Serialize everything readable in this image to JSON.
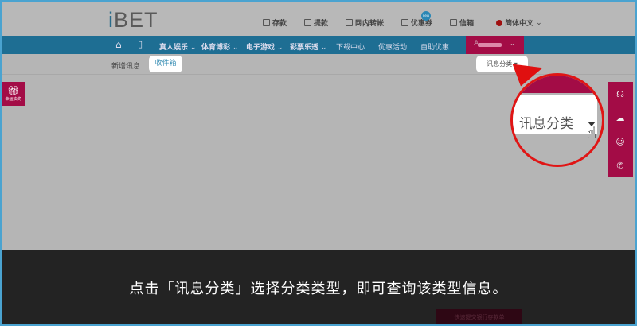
{
  "header": {
    "logo": "BET",
    "logo_i": "i",
    "links": [
      "存款",
      "提款",
      "网内转帐",
      "优惠券",
      "信箱"
    ],
    "new_badge": "new",
    "language": "简体中文"
  },
  "nav": {
    "items": [
      "真人娱乐",
      "体育博彩",
      "电子游戏",
      "彩票乐透",
      "下载中心",
      "优惠活动",
      "自助优惠"
    ]
  },
  "tabs": {
    "new_message": "新增讯息",
    "inbox": "收件箱",
    "category": "讯息分类"
  },
  "left_tab": "幸运抽奖",
  "magnifier": {
    "label": "讯息分类"
  },
  "caption": "点击「讯息分类」选择分类类型，即可查询该类型信息。",
  "bank_button": "快速提交银行存款单",
  "colors": {
    "nav": "#1e6e93",
    "accent": "#a30c46",
    "highlight": "#e01515"
  }
}
